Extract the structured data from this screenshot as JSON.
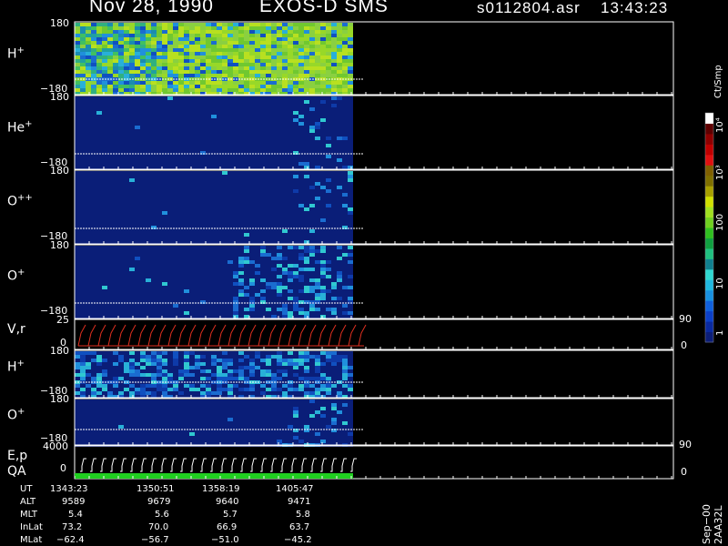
{
  "header": {
    "date": "Nov 28, 1990",
    "mission": "EXOS-D SMS",
    "filename": "s0112804.asr",
    "time": "13:43:23"
  },
  "panels": [
    {
      "name": "H+",
      "label": "H",
      "sup": "+",
      "ytop": "180",
      "ybot": "−180"
    },
    {
      "name": "He+",
      "label": "He",
      "sup": "+",
      "ytop": "180",
      "ybot": "−180"
    },
    {
      "name": "O++",
      "label": "O",
      "sup": "++",
      "ytop": "180",
      "ybot": "−180"
    },
    {
      "name": "O+",
      "label": "O",
      "sup": "+",
      "ytop": "180",
      "ybot": "−180"
    },
    {
      "name": "V,r",
      "label": "V,r",
      "sup": "",
      "ytop": "25",
      "ybot": "0",
      "right_top": "90",
      "right_bot": "0"
    },
    {
      "name": "H+ (2)",
      "label": "H",
      "sup": "+",
      "ytop": "180",
      "ybot": "−180"
    },
    {
      "name": "O+ (2)",
      "label": "O",
      "sup": "+",
      "ytop": "180",
      "ybot": "−180"
    },
    {
      "name": "E,p",
      "label": "E,p",
      "sup": "",
      "ytop": "4000",
      "ybot": "0",
      "right_top": "90",
      "right_bot": "0",
      "label2": "QA"
    }
  ],
  "colorbar": {
    "unit": "Ct/Smp",
    "ticks": [
      "1",
      "10",
      "100",
      "10³",
      "10⁴"
    ],
    "colors": [
      "#0c1e78",
      "#0a2aa0",
      "#0c40c8",
      "#1060dc",
      "#1890e0",
      "#20b8e0",
      "#30d8d0",
      "#108090",
      "#20c080",
      "#10a040",
      "#30c020",
      "#70d020",
      "#a0e020",
      "#d0e000",
      "#a8a000",
      "#807000",
      "#806000",
      "#e01010",
      "#c00000",
      "#900000",
      "#600000",
      "#ffffff"
    ]
  },
  "footer": {
    "rows": [
      {
        "label": "UT",
        "values": [
          "1343:23",
          "1350:51",
          "1358:19",
          "1405:47"
        ]
      },
      {
        "label": "ALT",
        "values": [
          "9589",
          "9679",
          "9640",
          "9471"
        ]
      },
      {
        "label": "MLT",
        "values": [
          "5.4",
          "5.6",
          "5.7",
          "5.8"
        ]
      },
      {
        "label": "InLat",
        "values": [
          "73.2",
          "70.0",
          "66.9",
          "63.7"
        ]
      },
      {
        "label": "MLat",
        "values": [
          "−62.4",
          "−56.7",
          "−51.0",
          "−45.2"
        ]
      }
    ],
    "side_text": "Sep−00  2AA32L"
  },
  "chart_data": {
    "type": "heatmap",
    "title": "Nov 28, 1990   EXOS-D SMS",
    "panels": [
      "H+",
      "He+",
      "O++",
      "O+",
      "V,r",
      "H+",
      "O+",
      "E,p"
    ],
    "y_range_pitch": [
      -180,
      180
    ],
    "colorbar_range": [
      1,
      10000
    ],
    "colorbar_scale": "log",
    "colorbar_unit": "Ct/Smp",
    "time_ticks": [
      "1343:23",
      "1350:51",
      "1358:19",
      "1405:47"
    ]
  }
}
